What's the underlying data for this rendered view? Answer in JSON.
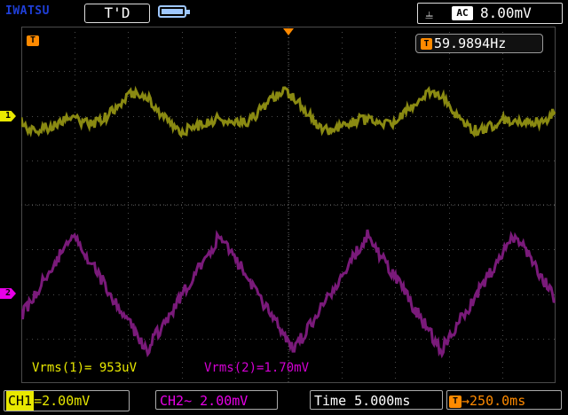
{
  "brand": "IWATSU",
  "trigger_status": "T'D",
  "trigger": {
    "edge_icon": "falling-edge-icon",
    "coupling": "AC",
    "level": "8.00mV"
  },
  "marker_t_label": "T",
  "ch1_marker_label": "1",
  "ch2_marker_label": "2",
  "frequency": {
    "label": "T",
    "value": "59.9894Hz"
  },
  "measurements": {
    "vrms1": "Vrms(1)= 953uV",
    "vrms2": "Vrms(2)=1.70mV"
  },
  "bottom": {
    "ch1_tag": "CH1",
    "ch1_coupling_icon": "=",
    "ch1_scale": "2.00mV",
    "ch2": "CH2~ 2.00mV",
    "time": "Time 5.000ms",
    "trig_pos_label": "T",
    "trig_pos": "→250.0ms"
  },
  "colors": {
    "ch1": "#e8e800",
    "ch2": "#e800e8",
    "trigger": "#ff8a00",
    "trace1": "#8a8a12",
    "trace2": "#7a1a7a"
  }
}
